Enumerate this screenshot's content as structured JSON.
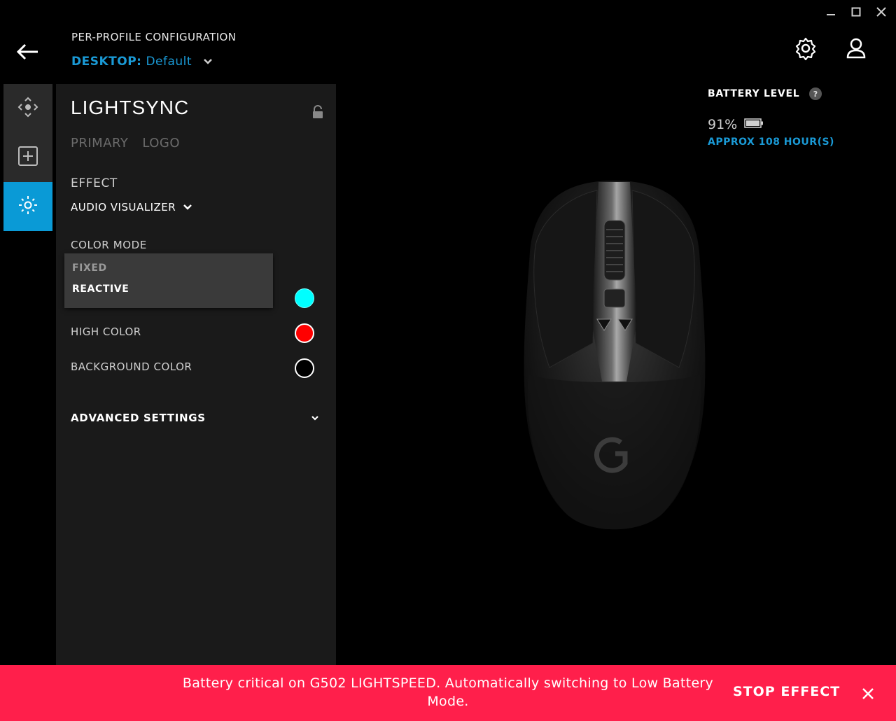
{
  "header": {
    "title": "PER-PROFILE CONFIGURATION",
    "profile_prefix": "DESKTOP:",
    "profile_name": "Default"
  },
  "panel": {
    "title": "LIGHTSYNC",
    "tabs": [
      "PRIMARY",
      "LOGO"
    ],
    "effect_label": "EFFECT",
    "effect_value": "AUDIO VISUALIZER",
    "color_mode_label": "COLOR MODE",
    "color_mode_options": [
      "FIXED",
      "REACTIVE"
    ],
    "colors": [
      {
        "label": "",
        "color": "#00ffff"
      },
      {
        "label": "HIGH COLOR",
        "color": "#ff0000"
      },
      {
        "label": "BACKGROUND COLOR",
        "color": "#000000"
      }
    ],
    "advanced_label": "ADVANCED SETTINGS"
  },
  "battery": {
    "title": "BATTERY LEVEL",
    "help": "?",
    "percent": "91%",
    "hours": "APPROX 108 HOUR(S)"
  },
  "banner": {
    "message": "Battery critical on G502 LIGHTSPEED. Automatically switching to Low Battery Mode.",
    "action": "STOP EFFECT"
  },
  "icons": {
    "window": [
      "minimize-icon",
      "maximize-icon",
      "close-icon"
    ],
    "top_right": [
      "gear-icon",
      "user-icon"
    ],
    "rail": [
      "move-icon",
      "plus-square-icon",
      "lightsync-icon"
    ]
  },
  "colors_theme": {
    "accent": "#1a9ad6",
    "panel_bg": "#1a1a1a",
    "banner": "#ff1f4b"
  }
}
